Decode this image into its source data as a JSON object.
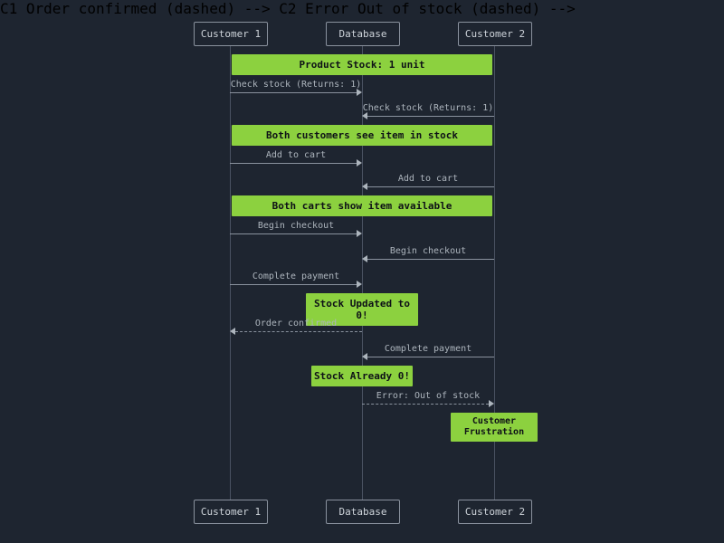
{
  "actors": {
    "c1": "Customer 1",
    "db": "Database",
    "c2": "Customer 2"
  },
  "notes": {
    "n1": "Product Stock: 1 unit",
    "n2": "Both customers see item in stock",
    "n3": "Both carts show item available",
    "n4": "Stock Updated to 0!",
    "n5": "Stock Already 0!",
    "n6": "Customer Frustration"
  },
  "msgs": {
    "m1": "Check stock (Returns: 1)",
    "m2": "Check stock (Returns: 1)",
    "m3": "Add to cart",
    "m4": "Add to cart",
    "m5": "Begin checkout",
    "m6": "Begin checkout",
    "m7": "Complete payment",
    "m8": "Order confirmed",
    "m9": "Complete payment",
    "m10": "Error: Out of stock"
  },
  "chart_data": {
    "type": "sequence-diagram",
    "participants": [
      "Customer 1",
      "Database",
      "Customer 2"
    ],
    "events": [
      {
        "kind": "note",
        "over": [
          "Customer 1",
          "Customer 2"
        ],
        "text": "Product Stock: 1 unit"
      },
      {
        "kind": "message",
        "from": "Customer 1",
        "to": "Database",
        "text": "Check stock (Returns: 1)",
        "style": "solid"
      },
      {
        "kind": "message",
        "from": "Customer 2",
        "to": "Database",
        "text": "Check stock (Returns: 1)",
        "style": "solid"
      },
      {
        "kind": "note",
        "over": [
          "Customer 1",
          "Customer 2"
        ],
        "text": "Both customers see item in stock"
      },
      {
        "kind": "message",
        "from": "Customer 1",
        "to": "Database",
        "text": "Add to cart",
        "style": "solid"
      },
      {
        "kind": "message",
        "from": "Customer 2",
        "to": "Database",
        "text": "Add to cart",
        "style": "solid"
      },
      {
        "kind": "note",
        "over": [
          "Customer 1",
          "Customer 2"
        ],
        "text": "Both carts show item available"
      },
      {
        "kind": "message",
        "from": "Customer 1",
        "to": "Database",
        "text": "Begin checkout",
        "style": "solid"
      },
      {
        "kind": "message",
        "from": "Customer 2",
        "to": "Database",
        "text": "Begin checkout",
        "style": "solid"
      },
      {
        "kind": "message",
        "from": "Customer 1",
        "to": "Database",
        "text": "Complete payment",
        "style": "solid"
      },
      {
        "kind": "note",
        "over": [
          "Database"
        ],
        "text": "Stock Updated to 0!"
      },
      {
        "kind": "message",
        "from": "Database",
        "to": "Customer 1",
        "text": "Order confirmed",
        "style": "dashed"
      },
      {
        "kind": "message",
        "from": "Customer 2",
        "to": "Database",
        "text": "Complete payment",
        "style": "solid"
      },
      {
        "kind": "note",
        "over": [
          "Database"
        ],
        "text": "Stock Already 0!"
      },
      {
        "kind": "message",
        "from": "Database",
        "to": "Customer 2",
        "text": "Error: Out of stock",
        "style": "dashed"
      },
      {
        "kind": "note",
        "over": [
          "Customer 2"
        ],
        "text": "Customer Frustration"
      }
    ]
  }
}
